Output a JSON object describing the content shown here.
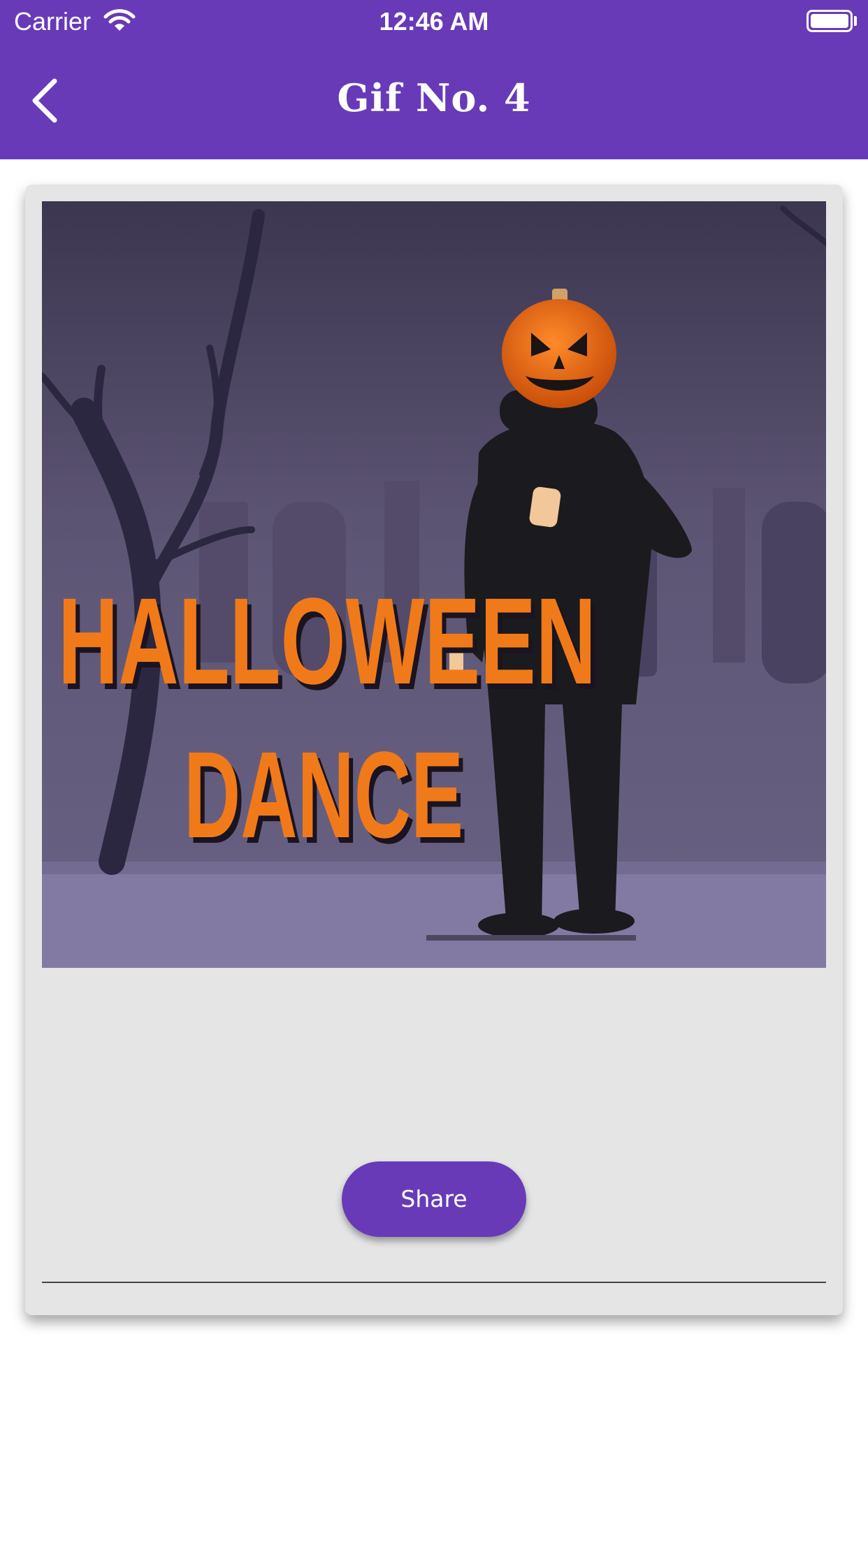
{
  "status_bar": {
    "carrier": "Carrier",
    "time": "12:46 AM"
  },
  "nav": {
    "title": "Gif No. 4"
  },
  "gif": {
    "text_line1": "HALLOWEEN",
    "text_line2": "DANCE"
  },
  "actions": {
    "share_label": "Share"
  },
  "colors": {
    "brand": "#683ab7",
    "card": "#e5e5e6",
    "pumpkin": "#f07a1a"
  }
}
